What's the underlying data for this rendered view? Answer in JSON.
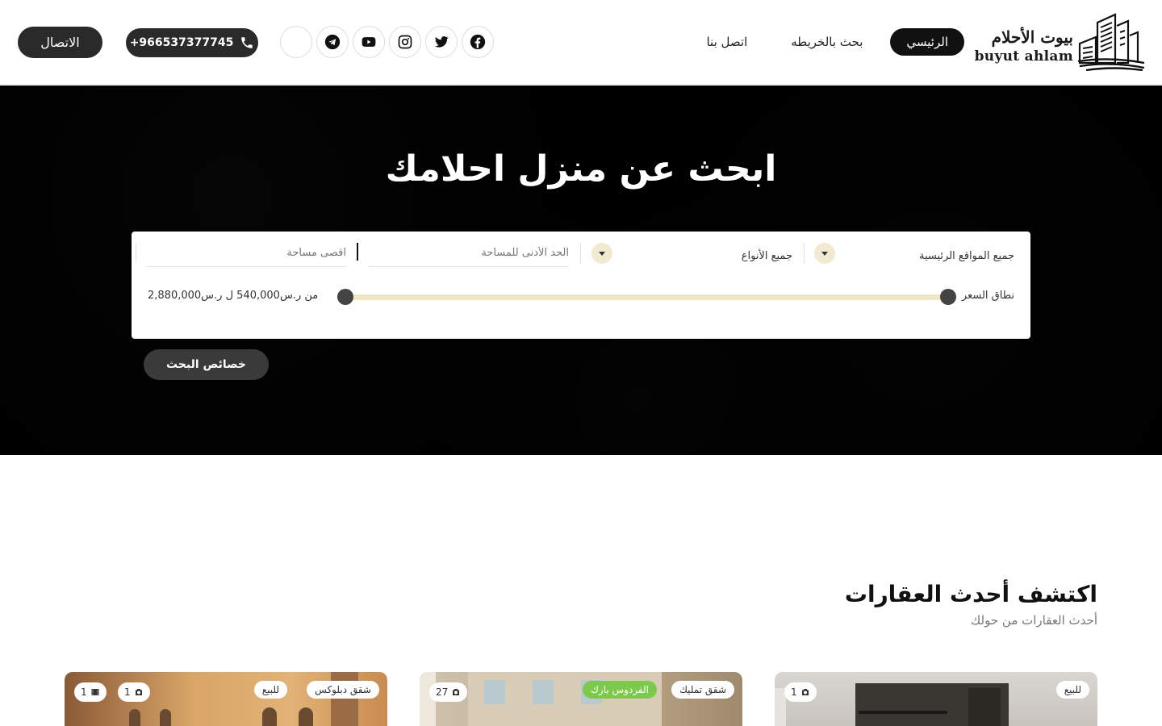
{
  "brand": {
    "name_ar": "بيوت الأحلام",
    "name_en": "buyut ahlam"
  },
  "nav": [
    {
      "label": "الرئيسي",
      "active": true
    },
    {
      "label": "بحث بالخريطه",
      "active": false
    },
    {
      "label": "اتصل بنا",
      "active": false
    }
  ],
  "socials": [
    "facebook-icon",
    "twitter-icon",
    "instagram-icon",
    "youtube-icon",
    "telegram-icon",
    "blank-icon"
  ],
  "phone": "+966537377745",
  "contact_label": "الاتصال",
  "hero": {
    "title": "ابحث عن منزل احلامك",
    "location": "جميع المواقع الرئيسية",
    "types": "جميع الأنواع",
    "min_area_placeholder": "الحد الأدنى للمساحة",
    "max_area_placeholder": "اقصى مساحة",
    "price_label": "نطاق السعر",
    "price_value": "من ر.س540,000 ل ر.س2,880,000",
    "features_button": "خصائص البحث"
  },
  "section": {
    "title": "اكتشف أحدث العقارات",
    "subtitle": "أحدث العقارات من حولك"
  },
  "cards": [
    {
      "tags": [
        "للبيع"
      ],
      "photos": "1",
      "videos": null
    },
    {
      "tags": [
        "شقق تمليك",
        "الفردوس بارك"
      ],
      "photos": "27",
      "videos": null
    },
    {
      "tags": [
        "شقق دبلوكس",
        "للبيع"
      ],
      "photos": "1",
      "videos": "1"
    }
  ],
  "colors": {
    "accent": "#f1ead1",
    "dark": "#2a2a2a",
    "green": "#7cc94b",
    "hero_bg": "#000000"
  }
}
